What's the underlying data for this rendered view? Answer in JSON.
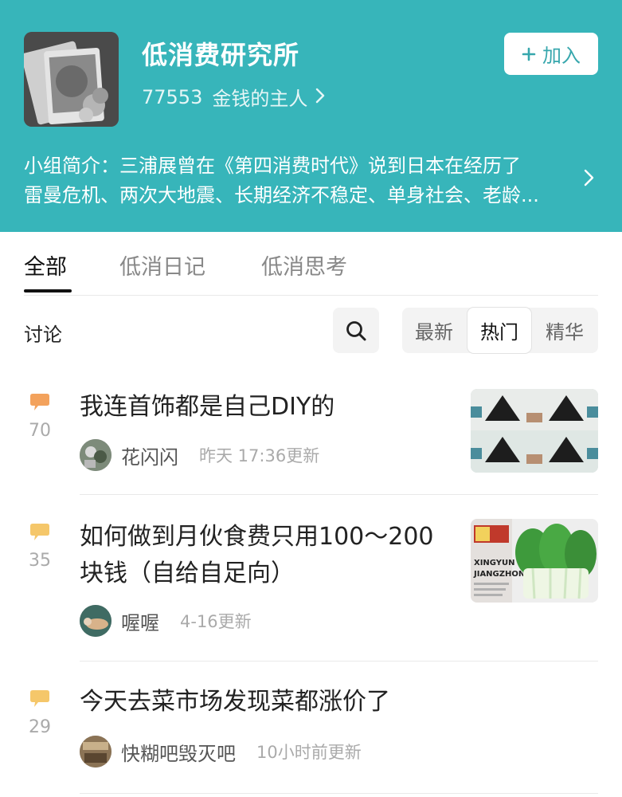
{
  "group": {
    "title": "低消费研究所",
    "member_count": "77553",
    "member_label": "金钱的主人",
    "join_label": "加入",
    "intro_label": "小组简介：",
    "intro_line1": "三浦展曾在《第四消费时代》说到日本在经历了",
    "intro_line2": "雷曼危机、两次大地震、长期经济不稳定、单身社会、老龄..."
  },
  "tabs": [
    {
      "label": "全部",
      "active": true
    },
    {
      "label": "低消日记",
      "active": false
    },
    {
      "label": "低消思考",
      "active": false
    }
  ],
  "filter": {
    "section_label": "讨论",
    "sort_options": [
      {
        "label": "最新",
        "active": false
      },
      {
        "label": "热门",
        "active": true
      },
      {
        "label": "精华",
        "active": false
      }
    ]
  },
  "topics": [
    {
      "reply_count": "70",
      "title_lines": [
        "我连首饰都是自己DIY的"
      ],
      "author": "花闪闪",
      "updated": "昨天 17:36更新",
      "has_thumbnail": true
    },
    {
      "reply_count": "35",
      "title_lines": [
        "如何做到月伙食费只用100～200",
        "块钱（自给自足向）"
      ],
      "author": "喔喔",
      "updated": "4-16更新",
      "has_thumbnail": true,
      "thumbnail_text": [
        "XINGYUN",
        "JIANGZHONG"
      ]
    },
    {
      "reply_count": "29",
      "title_lines": [
        "今天去菜市场发现菜都涨价了"
      ],
      "author": "快糊吧毁灭吧",
      "updated": "10小时前更新",
      "has_thumbnail": false
    }
  ],
  "colors": {
    "header_bg": "#37b5ba",
    "reply_icon": "#f5c76a",
    "reply_icon_hot": "#f3a25c"
  },
  "icons": {
    "reply": "speech-bubble-icon",
    "search": "search-icon",
    "chevron": "chevron-right-icon",
    "plus": "plus-icon"
  }
}
